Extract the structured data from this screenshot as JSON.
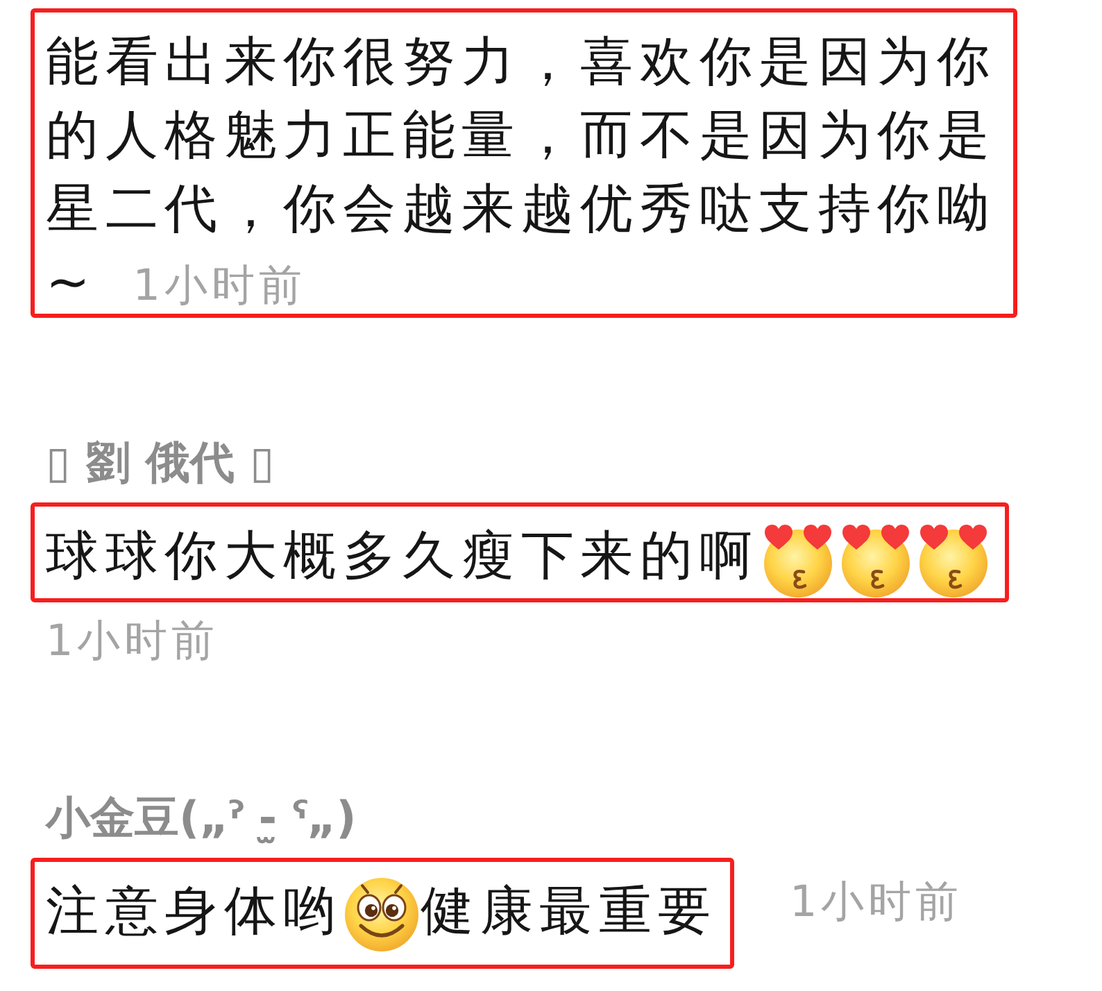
{
  "comments": [
    {
      "kind": "inline",
      "highlighted": true,
      "parts": [
        {
          "kind": "text",
          "text": "能看出来你很努力，喜欢你是因为你的人格魅力正能量，而不是因为你是星二代，你会越来越优秀哒支持你呦"
        },
        {
          "kind": "text",
          "text": "~"
        }
      ],
      "time": "1小时前"
    },
    {
      "kind": "below",
      "username": "▯ 劉 俄代 ▯",
      "highlighted": true,
      "parts": [
        {
          "kind": "text",
          "text": "球球你大概多久瘦下来的啊"
        },
        {
          "kind": "lovestruck"
        },
        {
          "kind": "lovestruck"
        },
        {
          "kind": "lovestruck"
        }
      ],
      "time": "1小时前"
    },
    {
      "kind": "beside",
      "username": "小金豆(„ˀ -̫ ˁ„)",
      "highlighted": true,
      "parts": [
        {
          "kind": "text",
          "text": "注意身体哟"
        },
        {
          "kind": "smiley"
        },
        {
          "kind": "text",
          "text": "健康最重要"
        }
      ],
      "time": "1小时前"
    }
  ]
}
